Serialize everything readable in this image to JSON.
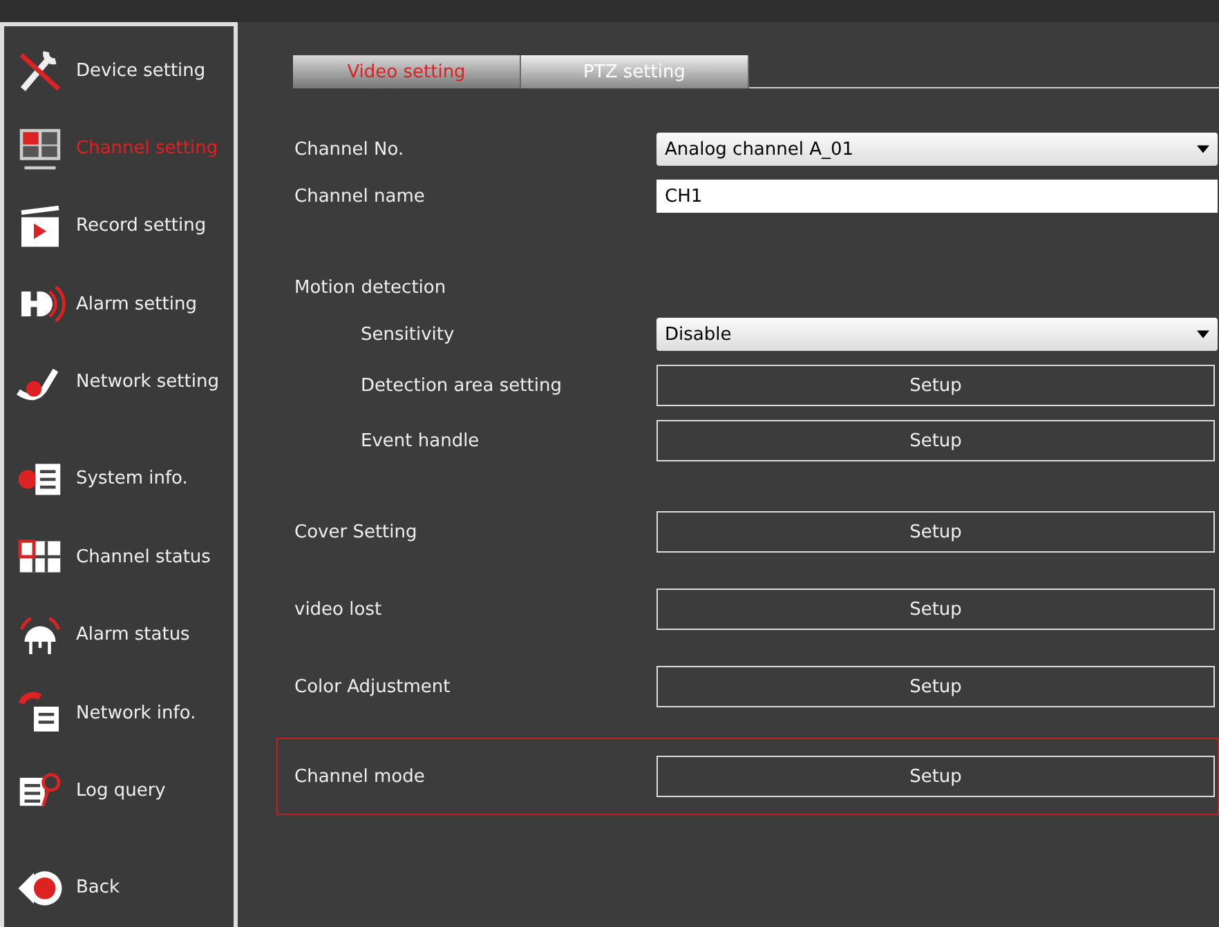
{
  "sidebar": {
    "items": [
      {
        "label": "Device setting",
        "selected": false
      },
      {
        "label": "Channel setting",
        "selected": true
      },
      {
        "label": "Record setting",
        "selected": false
      },
      {
        "label": "Alarm setting",
        "selected": false
      },
      {
        "label": "Network setting",
        "selected": false
      },
      {
        "label": "System info.",
        "selected": false
      },
      {
        "label": "Channel status",
        "selected": false
      },
      {
        "label": "Alarm status",
        "selected": false
      },
      {
        "label": "Network info.",
        "selected": false
      },
      {
        "label": "Log query",
        "selected": false
      },
      {
        "label": "Back",
        "selected": false
      }
    ]
  },
  "tabs": [
    {
      "label": "Video setting",
      "selected": true
    },
    {
      "label": "PTZ setting",
      "selected": false
    }
  ],
  "rows": [
    {
      "label": "Channel No.",
      "kind": "select",
      "value": "Analog channel A_01",
      "indent": false,
      "highlighted": false
    },
    {
      "label": "Channel name",
      "kind": "input",
      "value": "CH1",
      "indent": false,
      "highlighted": false
    },
    {
      "label": "Motion detection",
      "kind": "heading",
      "indent": false,
      "highlighted": false
    },
    {
      "label": "Sensitivity",
      "kind": "select",
      "value": "Disable",
      "indent": true,
      "highlighted": false
    },
    {
      "label": "Detection area setting",
      "kind": "button",
      "value": "Setup",
      "indent": true,
      "highlighted": false
    },
    {
      "label": "Event handle",
      "kind": "button",
      "value": "Setup",
      "indent": true,
      "highlighted": false
    },
    {
      "label": "Cover Setting",
      "kind": "button",
      "value": "Setup",
      "indent": false,
      "highlighted": false
    },
    {
      "label": "video lost",
      "kind": "button",
      "value": "Setup",
      "indent": false,
      "highlighted": false
    },
    {
      "label": "Color Adjustment",
      "kind": "button",
      "value": "Setup",
      "indent": false,
      "highlighted": false
    },
    {
      "label": "Channel mode",
      "kind": "button",
      "value": "Setup",
      "indent": false,
      "highlighted": true
    }
  ]
}
